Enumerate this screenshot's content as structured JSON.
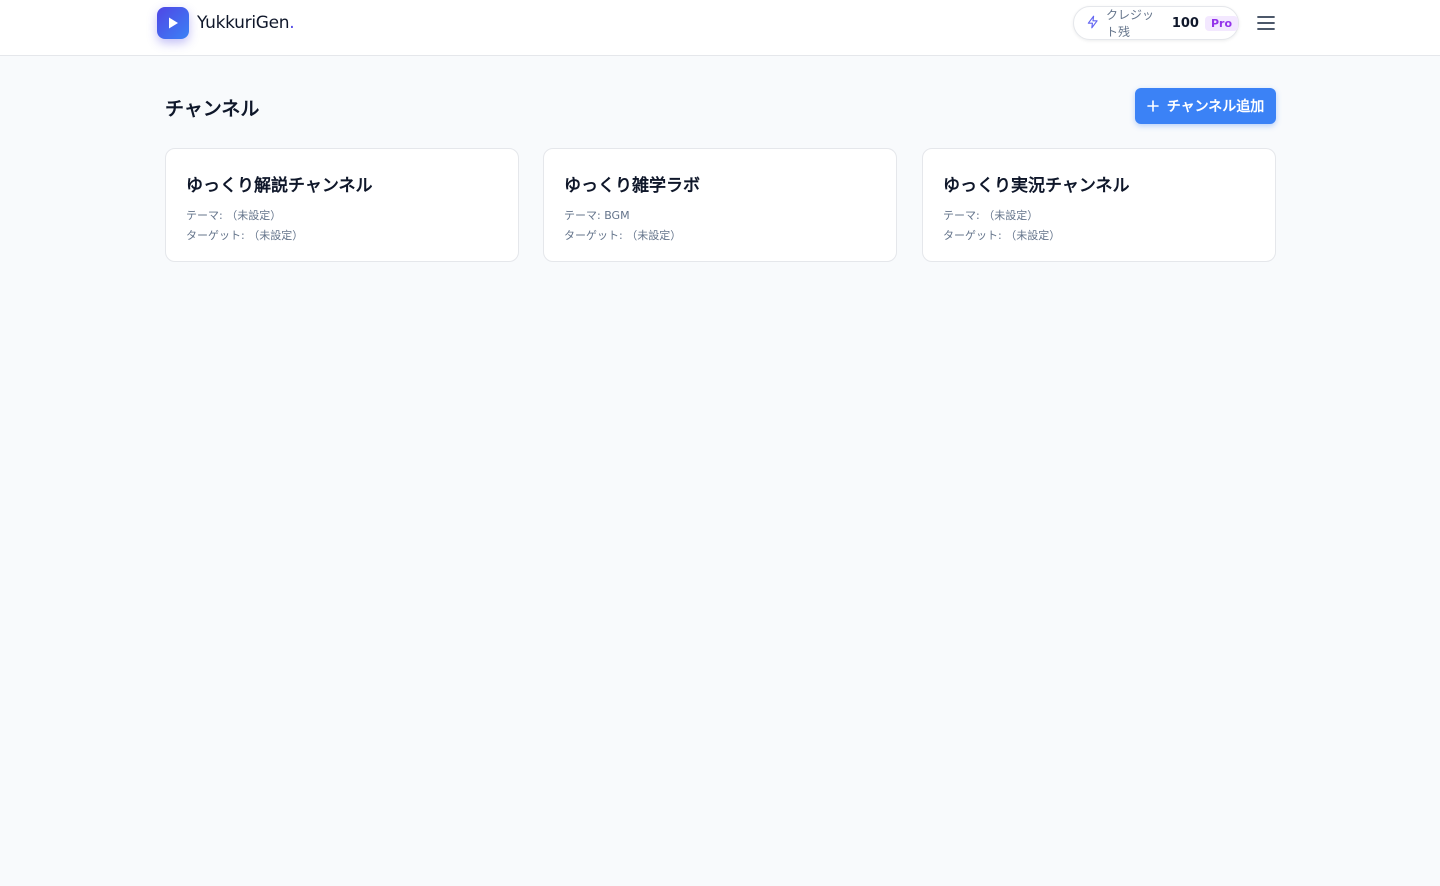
{
  "header": {
    "app_name": "YukkuriGen",
    "app_name_suffix": ".",
    "credits": {
      "label": "クレジット残",
      "value": "100",
      "plan": "Pro"
    },
    "icons": {
      "logo": "play-icon",
      "credit": "lightning-icon",
      "menu": "hamburger-menu-icon"
    }
  },
  "main": {
    "title": "チャンネル",
    "add_button_label": "チャンネル追加",
    "channels": [
      {
        "name": "ゆっくり解説チャンネル",
        "theme_line": "テーマ: （未設定）",
        "target_line": "ターゲット: （未設定）"
      },
      {
        "name": "ゆっくり雑学ラボ",
        "theme_line": "テーマ: BGM",
        "target_line": "ターゲット: （未設定）"
      },
      {
        "name": "ゆっくり実況チャンネル",
        "theme_line": "テーマ: （未設定）",
        "target_line": "ターゲット: （未設定）"
      }
    ]
  },
  "colors": {
    "accent": "#3b82f6",
    "brand": "#4f46e5",
    "pro_badge": "#9333ea",
    "background": "#f8fafc"
  }
}
